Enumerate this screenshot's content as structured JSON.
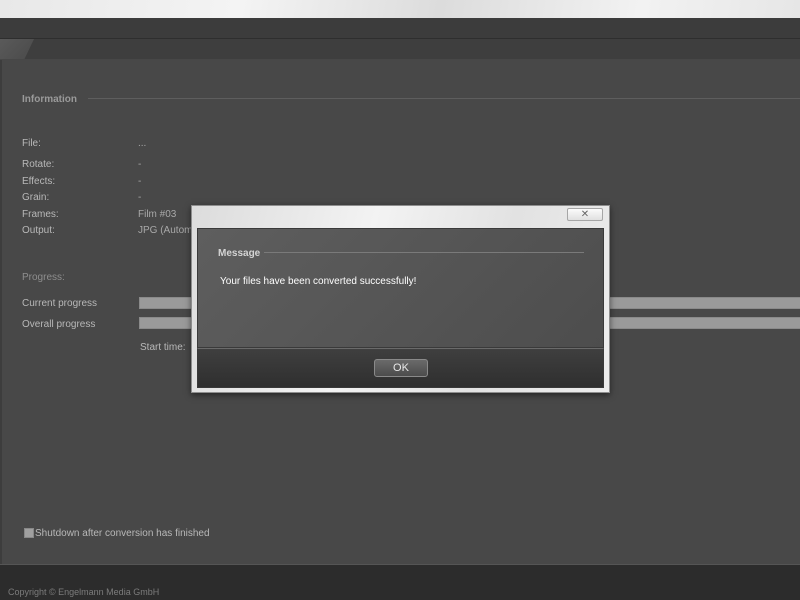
{
  "info": {
    "title": "Information",
    "rows": [
      {
        "label": "File:",
        "value": "..."
      },
      {
        "label": "Rotate:",
        "value": "-"
      },
      {
        "label": "Effects:",
        "value": "-"
      },
      {
        "label": "Grain:",
        "value": "-"
      },
      {
        "label": "Frames:",
        "value": "Film #03"
      },
      {
        "label": "Output:",
        "value": "JPG (Automa"
      }
    ]
  },
  "progress": {
    "title": "Progress:",
    "current_label": "Current progress",
    "overall_label": "Overall progress",
    "start_time_label": "Start time:"
  },
  "options": {
    "shutdown_label": "Shutdown after conversion has finished",
    "shutdown_checked": false
  },
  "footer": {
    "copyright": "Copyright © Engelmann Media GmbH"
  },
  "dialog": {
    "close_glyph": "✕",
    "title": "Message",
    "message": "Your files have been converted successfully!",
    "ok_label": "OK"
  }
}
